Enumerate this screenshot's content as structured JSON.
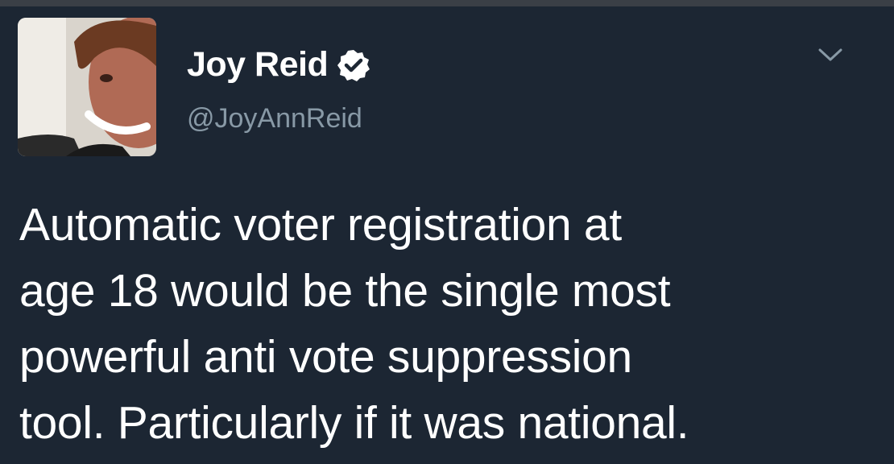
{
  "tweet": {
    "author": {
      "display_name": "Joy Reid",
      "handle": "@JoyAnnReid",
      "verified": true,
      "avatar_icon": "profile-photo"
    },
    "menu_icon": "chevron-down-icon",
    "text_lines": [
      "Automatic voter registration at",
      "age 18 would be the single most",
      "powerful anti vote suppression",
      "tool. Particularly if it was national."
    ]
  },
  "colors": {
    "background": "#1c2633",
    "text": "#ffffff",
    "handle": "#8899a6",
    "verified_badge": "#ffffff"
  }
}
